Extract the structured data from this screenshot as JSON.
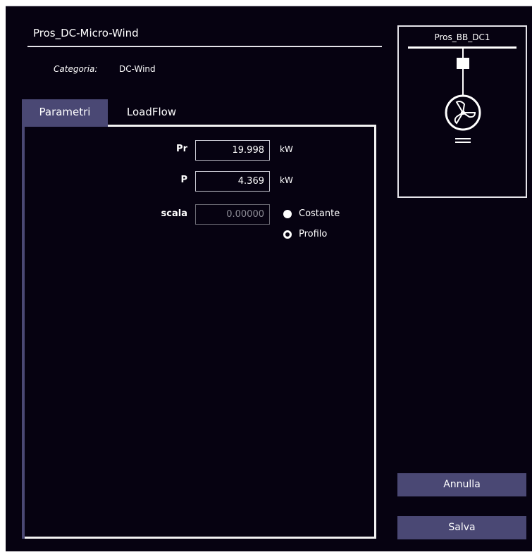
{
  "window": {
    "title": "Pros_DC-Micro-Wind"
  },
  "category": {
    "label": "Categoria:",
    "value": "DC-Wind"
  },
  "tabs": [
    {
      "label": "Parametri",
      "active": true
    },
    {
      "label": "LoadFlow",
      "active": false
    }
  ],
  "fields": {
    "pr": {
      "label": "Pr",
      "value": "19.998",
      "unit": "kW"
    },
    "p": {
      "label": "P",
      "value": "4.369",
      "unit": "kW"
    },
    "scala": {
      "label": "scala",
      "value": "0.00000",
      "enabled": false
    }
  },
  "scala_mode": {
    "options": [
      {
        "label": "Costante",
        "selected": true
      },
      {
        "label": "Profilo",
        "selected": false
      }
    ]
  },
  "diagram": {
    "bus_label": "Pros_BB_DC1",
    "symbol": "wind-turbine-icon"
  },
  "buttons": {
    "cancel": "Annulla",
    "save": "Salva"
  },
  "colors": {
    "background": "#060211",
    "accent": "#4a4874",
    "text": "#ffffff",
    "border": "#f2f2f2"
  }
}
